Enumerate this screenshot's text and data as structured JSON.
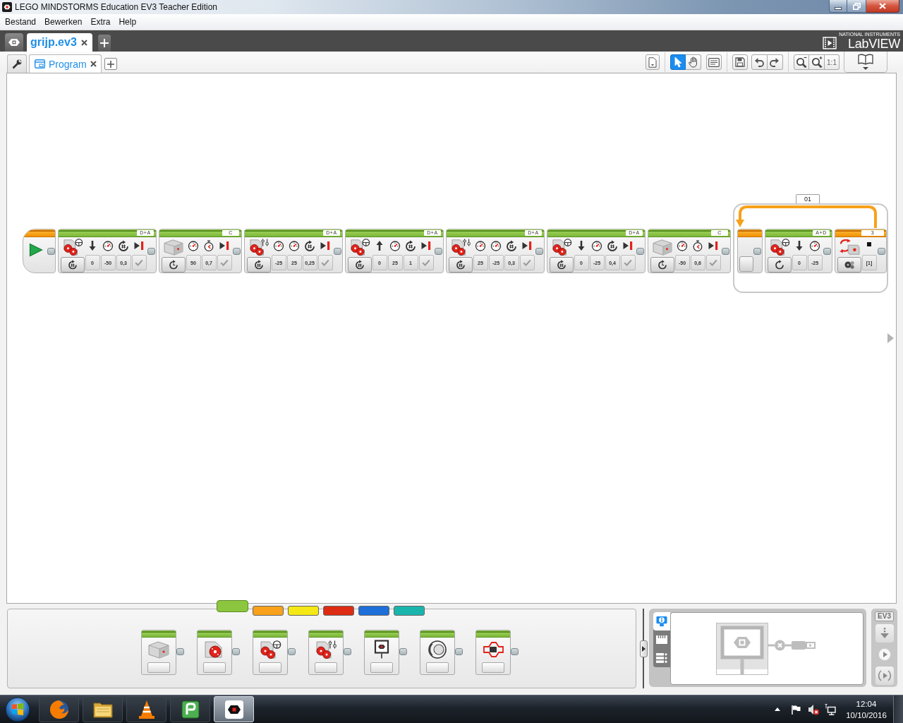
{
  "window": {
    "title": "LEGO MINDSTORMS Education EV3 Teacher Edition"
  },
  "menu": [
    {
      "label": "Bestand"
    },
    {
      "label": "Bewerken"
    },
    {
      "label": "Extra"
    },
    {
      "label": "Help"
    }
  ],
  "project_tabs": [
    {
      "label": "grijp.ev3",
      "selected": true
    }
  ],
  "brand": {
    "maker": "NATIONAL INSTRUMENTS",
    "name": "LabVIEW"
  },
  "program_tabs": [
    {
      "label": "Program",
      "selected": true
    }
  ],
  "toolbar": {
    "tools": [
      {
        "kind": "pointer",
        "selected": true
      },
      {
        "kind": "hand",
        "selected": false
      }
    ],
    "zoom_reset": "1:1"
  },
  "program": {
    "sequence": [
      {
        "kind": "start"
      },
      {
        "kind": "move_steering",
        "port": "D+A",
        "mode": {
          "kind": "rotations"
        },
        "params": [
          {
            "kind": "direction_down",
            "value": "0"
          },
          {
            "kind": "power",
            "value": "-50"
          },
          {
            "kind": "rotations",
            "value": "0,3"
          },
          {
            "kind": "brake",
            "on": true
          }
        ]
      },
      {
        "kind": "medium_motor",
        "port": "C",
        "mode": {
          "kind": "seconds"
        },
        "params": [
          {
            "kind": "power",
            "value": "50"
          },
          {
            "kind": "seconds",
            "value": "0,7"
          },
          {
            "kind": "brake",
            "on": true
          }
        ]
      },
      {
        "kind": "move_tank",
        "port": "D+A",
        "mode": {
          "kind": "rotations"
        },
        "params": [
          {
            "kind": "power",
            "value": "-25"
          },
          {
            "kind": "power",
            "value": "25"
          },
          {
            "kind": "rotations",
            "value": "0,25"
          },
          {
            "kind": "brake",
            "on": true
          }
        ]
      },
      {
        "kind": "move_steering",
        "port": "D+A",
        "mode": {
          "kind": "rotations"
        },
        "params": [
          {
            "kind": "direction_up",
            "value": "0"
          },
          {
            "kind": "power",
            "value": "25"
          },
          {
            "kind": "rotations",
            "value": "1"
          },
          {
            "kind": "brake",
            "on": true
          }
        ]
      },
      {
        "kind": "move_tank",
        "port": "D+A",
        "mode": {
          "kind": "rotations"
        },
        "params": [
          {
            "kind": "power",
            "value": "25"
          },
          {
            "kind": "power",
            "value": "-25"
          },
          {
            "kind": "rotations",
            "value": "0,3"
          },
          {
            "kind": "brake",
            "on": true
          }
        ]
      },
      {
        "kind": "move_steering",
        "port": "D+A",
        "mode": {
          "kind": "rotations"
        },
        "params": [
          {
            "kind": "direction_down",
            "value": "0"
          },
          {
            "kind": "power",
            "value": "-25"
          },
          {
            "kind": "rotations",
            "value": "0,4"
          },
          {
            "kind": "brake",
            "on": true
          }
        ]
      },
      {
        "kind": "medium_motor",
        "port": "C",
        "mode": {
          "kind": "seconds"
        },
        "params": [
          {
            "kind": "power",
            "value": "-50"
          },
          {
            "kind": "seconds",
            "value": "0,6"
          },
          {
            "kind": "brake",
            "on": true
          }
        ]
      },
      {
        "kind": "loop",
        "name": "01",
        "blocks": [
          {
            "kind": "move_steering",
            "port": "A+D",
            "mode": {
              "kind": "on"
            },
            "params": [
              {
                "kind": "direction_down",
                "value": "0"
              },
              {
                "kind": "power",
                "value": "-25"
              }
            ]
          },
          {
            "kind": "wait_color",
            "port": "3",
            "mode": {
              "kind": "color"
            },
            "params": [
              {
                "kind": "colors",
                "value": "[1]"
              }
            ]
          }
        ]
      }
    ]
  },
  "palette": {
    "tabs": [
      {
        "color": "#8cc63f",
        "selected": true
      },
      {
        "color": "#f9a11b",
        "selected": false
      },
      {
        "color": "#f5e814",
        "selected": false
      },
      {
        "color": "#dd2c13",
        "selected": false
      },
      {
        "color": "#1e6fd9",
        "selected": false
      },
      {
        "color": "#19b5ad",
        "selected": false
      }
    ],
    "blocks": [
      {
        "kind": "medium_motor"
      },
      {
        "kind": "large_motor"
      },
      {
        "kind": "move_steering"
      },
      {
        "kind": "move_tank"
      },
      {
        "kind": "display"
      },
      {
        "kind": "sound"
      },
      {
        "kind": "brick_light"
      }
    ]
  },
  "hardware": {
    "tabs": [
      {
        "kind": "info",
        "selected": true
      },
      {
        "kind": "ports",
        "selected": false
      },
      {
        "kind": "files",
        "selected": false
      }
    ],
    "connected": false,
    "brick_label": "EV3"
  },
  "taskbar": {
    "apps": [
      {
        "kind": "browser",
        "selected": false
      },
      {
        "kind": "folder",
        "selected": false
      },
      {
        "kind": "cone",
        "selected": false
      },
      {
        "kind": "tile",
        "selected": false
      },
      {
        "kind": "ev3",
        "selected": true
      }
    ],
    "time": "12:04",
    "date": "10/10/2016"
  }
}
